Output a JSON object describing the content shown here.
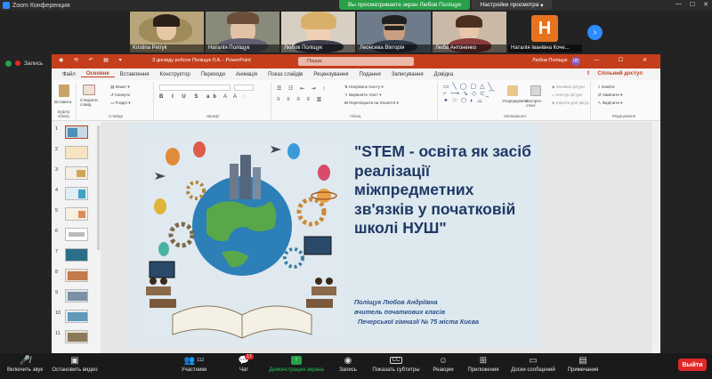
{
  "window": {
    "title": "Zoom Конференция"
  },
  "banner": {
    "sharing_text": "Вы просматриваете экран Любов Поліщук",
    "view_options": "Настройки просмотра"
  },
  "participants": [
    {
      "name": "Kristina Petryk"
    },
    {
      "name": "Наталія Поліщук"
    },
    {
      "name": "Любов Поліщук"
    },
    {
      "name": "Леонсева Вікторія"
    },
    {
      "name": "Люба Антоненко"
    },
    {
      "name": "Наталія Іванівна Коче...",
      "initial": "H"
    }
  ],
  "recording": {
    "label": "Запись"
  },
  "powerpoint": {
    "doc_title": "З досвіду роботи Поліщук Л.А. - PowerPoint",
    "search_placeholder": "Пошук",
    "user_name": "Любов Поліщук",
    "user_initials": "ЛП",
    "tabs": [
      "Файл",
      "Основне",
      "Вставлення",
      "Конструктор",
      "Переходи",
      "Анімація",
      "Показ слайдів",
      "Рецензування",
      "Подання",
      "Записування",
      "Довідка"
    ],
    "active_tab": "Основне",
    "shared_access": "Спільний доступ",
    "ribbon": {
      "clipboard": {
        "paste": "Вставити",
        "label": "Буфер обміну"
      },
      "slides": {
        "new_slide": "Створити слайд",
        "layout": "Макет",
        "reset": "Скинути",
        "section": "Розділ",
        "label": "Слайди"
      },
      "font": {
        "label": "Шрифт"
      },
      "paragraph": {
        "text_direction": "Напрямок тексту",
        "align_text": "Вирівняти текст",
        "smartart": "Перетворити на SmartArt",
        "label": "Абзац"
      },
      "drawing": {
        "arrange": "Упорядкувати",
        "quick_styles": "Експрес-стилі",
        "fill": "Заливка фігури",
        "outline": "Контур фігури",
        "effects": "Ефекти для фігур",
        "label": "Малювання"
      },
      "editing": {
        "find": "Знайти",
        "replace": "Замінити",
        "select": "Виділити",
        "label": "Редагування"
      }
    },
    "slide_numbers": [
      "1",
      "2",
      "3",
      "4",
      "5",
      "6",
      "7",
      "8",
      "9",
      "10",
      "11"
    ],
    "slide": {
      "title": "\"STEM - освіта як засіб реалізації міжпредметних зв'язків у початковій школі НУШ\"",
      "author_line1": "Поліщук Любов Андріївна",
      "author_line2": "вчитель початкових класів",
      "author_line3": "Печерської гімназії № 75 міста Києва"
    }
  },
  "toolbar": {
    "mute": "Включить звук",
    "video": "Остановить видео",
    "participants": "Участники",
    "participants_count": "112",
    "chat": "Чат",
    "chat_badge": "17",
    "share": "Демонстрация экрана",
    "record": "Запись",
    "captions": "Показать субтитры",
    "reactions": "Реакции",
    "apps": "Приложения",
    "whiteboards": "Доски сообщений",
    "notes": "Примечания",
    "exit": "Выйти"
  }
}
